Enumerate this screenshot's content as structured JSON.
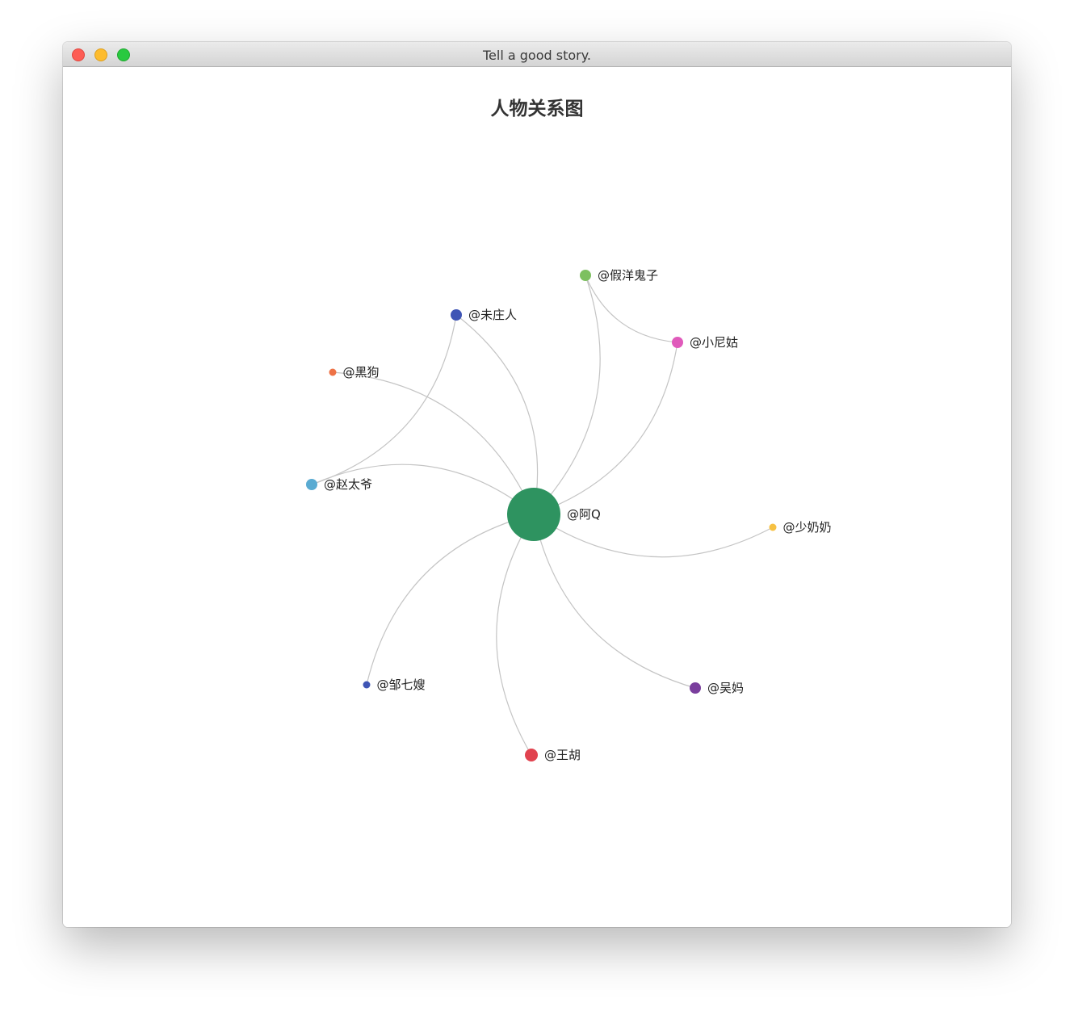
{
  "window": {
    "title": "Tell a good story."
  },
  "graph": {
    "title": "人物关系图",
    "edge_color": "#c4c4c4",
    "nodes": [
      {
        "id": "aq",
        "label": "@阿Q",
        "color": "#2e9360"
      },
      {
        "id": "jiayang",
        "label": "@假洋鬼子",
        "color": "#7dc060"
      },
      {
        "id": "weizhuang",
        "label": "@未庄人",
        "color": "#3f55b5"
      },
      {
        "id": "xiaonigu",
        "label": "@小尼姑",
        "color": "#e05abb"
      },
      {
        "id": "heigou",
        "label": "@黑狗",
        "color": "#ee7246"
      },
      {
        "id": "zhaotaiye",
        "label": "@赵太爷",
        "color": "#5aabd2"
      },
      {
        "id": "shaonainai",
        "label": "@少奶奶",
        "color": "#f6c143"
      },
      {
        "id": "zouqisao",
        "label": "@邹七嫂",
        "color": "#3f55b5"
      },
      {
        "id": "wuma",
        "label": "@吴妈",
        "color": "#7a3e9d"
      },
      {
        "id": "wanghu",
        "label": "@王胡",
        "color": "#e1434f"
      }
    ],
    "edges": [
      {
        "source": "aq",
        "target": "jiayang"
      },
      {
        "source": "aq",
        "target": "weizhuang"
      },
      {
        "source": "aq",
        "target": "xiaonigu"
      },
      {
        "source": "aq",
        "target": "heigou"
      },
      {
        "source": "aq",
        "target": "zhaotaiye"
      },
      {
        "source": "aq",
        "target": "shaonainai"
      },
      {
        "source": "aq",
        "target": "zouqisao"
      },
      {
        "source": "aq",
        "target": "wuma"
      },
      {
        "source": "aq",
        "target": "wanghu"
      },
      {
        "source": "zhaotaiye",
        "target": "weizhuang"
      },
      {
        "source": "jiayang",
        "target": "xiaonigu"
      }
    ]
  }
}
